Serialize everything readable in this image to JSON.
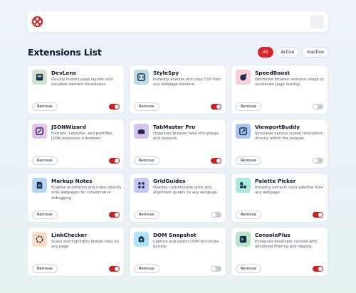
{
  "header": {
    "logo": "extensions-logo-icon",
    "theme_toggle_icon": "sun-icon"
  },
  "page": {
    "title": "Extensions List"
  },
  "filters": [
    {
      "label": "All",
      "active": true
    },
    {
      "label": "Active",
      "active": false
    },
    {
      "label": "Inactive",
      "active": false
    }
  ],
  "remove_label": "Remove",
  "extensions": [
    {
      "name": "DevLens",
      "description": "Quickly inspect page layouts and visualize element boundaries.",
      "enabled": true,
      "icon": "devlens-icon",
      "icon_bg": "#cfe3cf"
    },
    {
      "name": "StyleSpy",
      "description": "Instantly analyze and copy CSS from any webpage element.",
      "enabled": true,
      "icon": "stylespy-icon",
      "icon_bg": "#b9dde3"
    },
    {
      "name": "SpeedBoost",
      "description": "Optimizes browser resource usage to accelerate page loading.",
      "enabled": false,
      "icon": "speedboost-icon",
      "icon_bg": "#f7cfd4"
    },
    {
      "name": "JSONWizard",
      "description": "Formats, validates, and prettifies JSON responses in-browser.",
      "enabled": true,
      "icon": "jsonwizard-icon",
      "icon_bg": "#e7c3ea"
    },
    {
      "name": "TabMaster Pro",
      "description": "Organizes browser tabs into groups and sessions.",
      "enabled": true,
      "icon": "tabmaster-icon",
      "icon_bg": "#d4c4ef"
    },
    {
      "name": "ViewportBuddy",
      "description": "Simulates various screen resolutions directly within the browser.",
      "enabled": false,
      "icon": "viewportbuddy-icon",
      "icon_bg": "#a9c6f0"
    },
    {
      "name": "Markup Notes",
      "description": "Enables annotation and notes directly onto webpages for collaborative debugging.",
      "enabled": true,
      "icon": "markup-notes-icon",
      "icon_bg": "#b4d6f5"
    },
    {
      "name": "GridGuides",
      "description": "Overlay customizable grids and alignment guides on any webpage.",
      "enabled": false,
      "icon": "gridguides-icon",
      "icon_bg": "#c6c8f5"
    },
    {
      "name": "Palette Picker",
      "description": "Instantly extracts color palettes from any webpage.",
      "enabled": true,
      "icon": "palette-picker-icon",
      "icon_bg": "#a8eadd"
    },
    {
      "name": "LinkChecker",
      "description": "Scans and highlights broken links on any page.",
      "enabled": true,
      "icon": "linkchecker-icon",
      "icon_bg": "#f7dcc6"
    },
    {
      "name": "DOM Snapshot",
      "description": "Capture and export DOM structures quickly.",
      "enabled": false,
      "icon": "dom-snapshot-icon",
      "icon_bg": "#a9e5f3"
    },
    {
      "name": "ConsolePlus",
      "description": "Enhanced developer console with advanced filtering and logging.",
      "enabled": true,
      "icon": "consoleplus-icon",
      "icon_bg": "#b6e6c4"
    }
  ]
}
